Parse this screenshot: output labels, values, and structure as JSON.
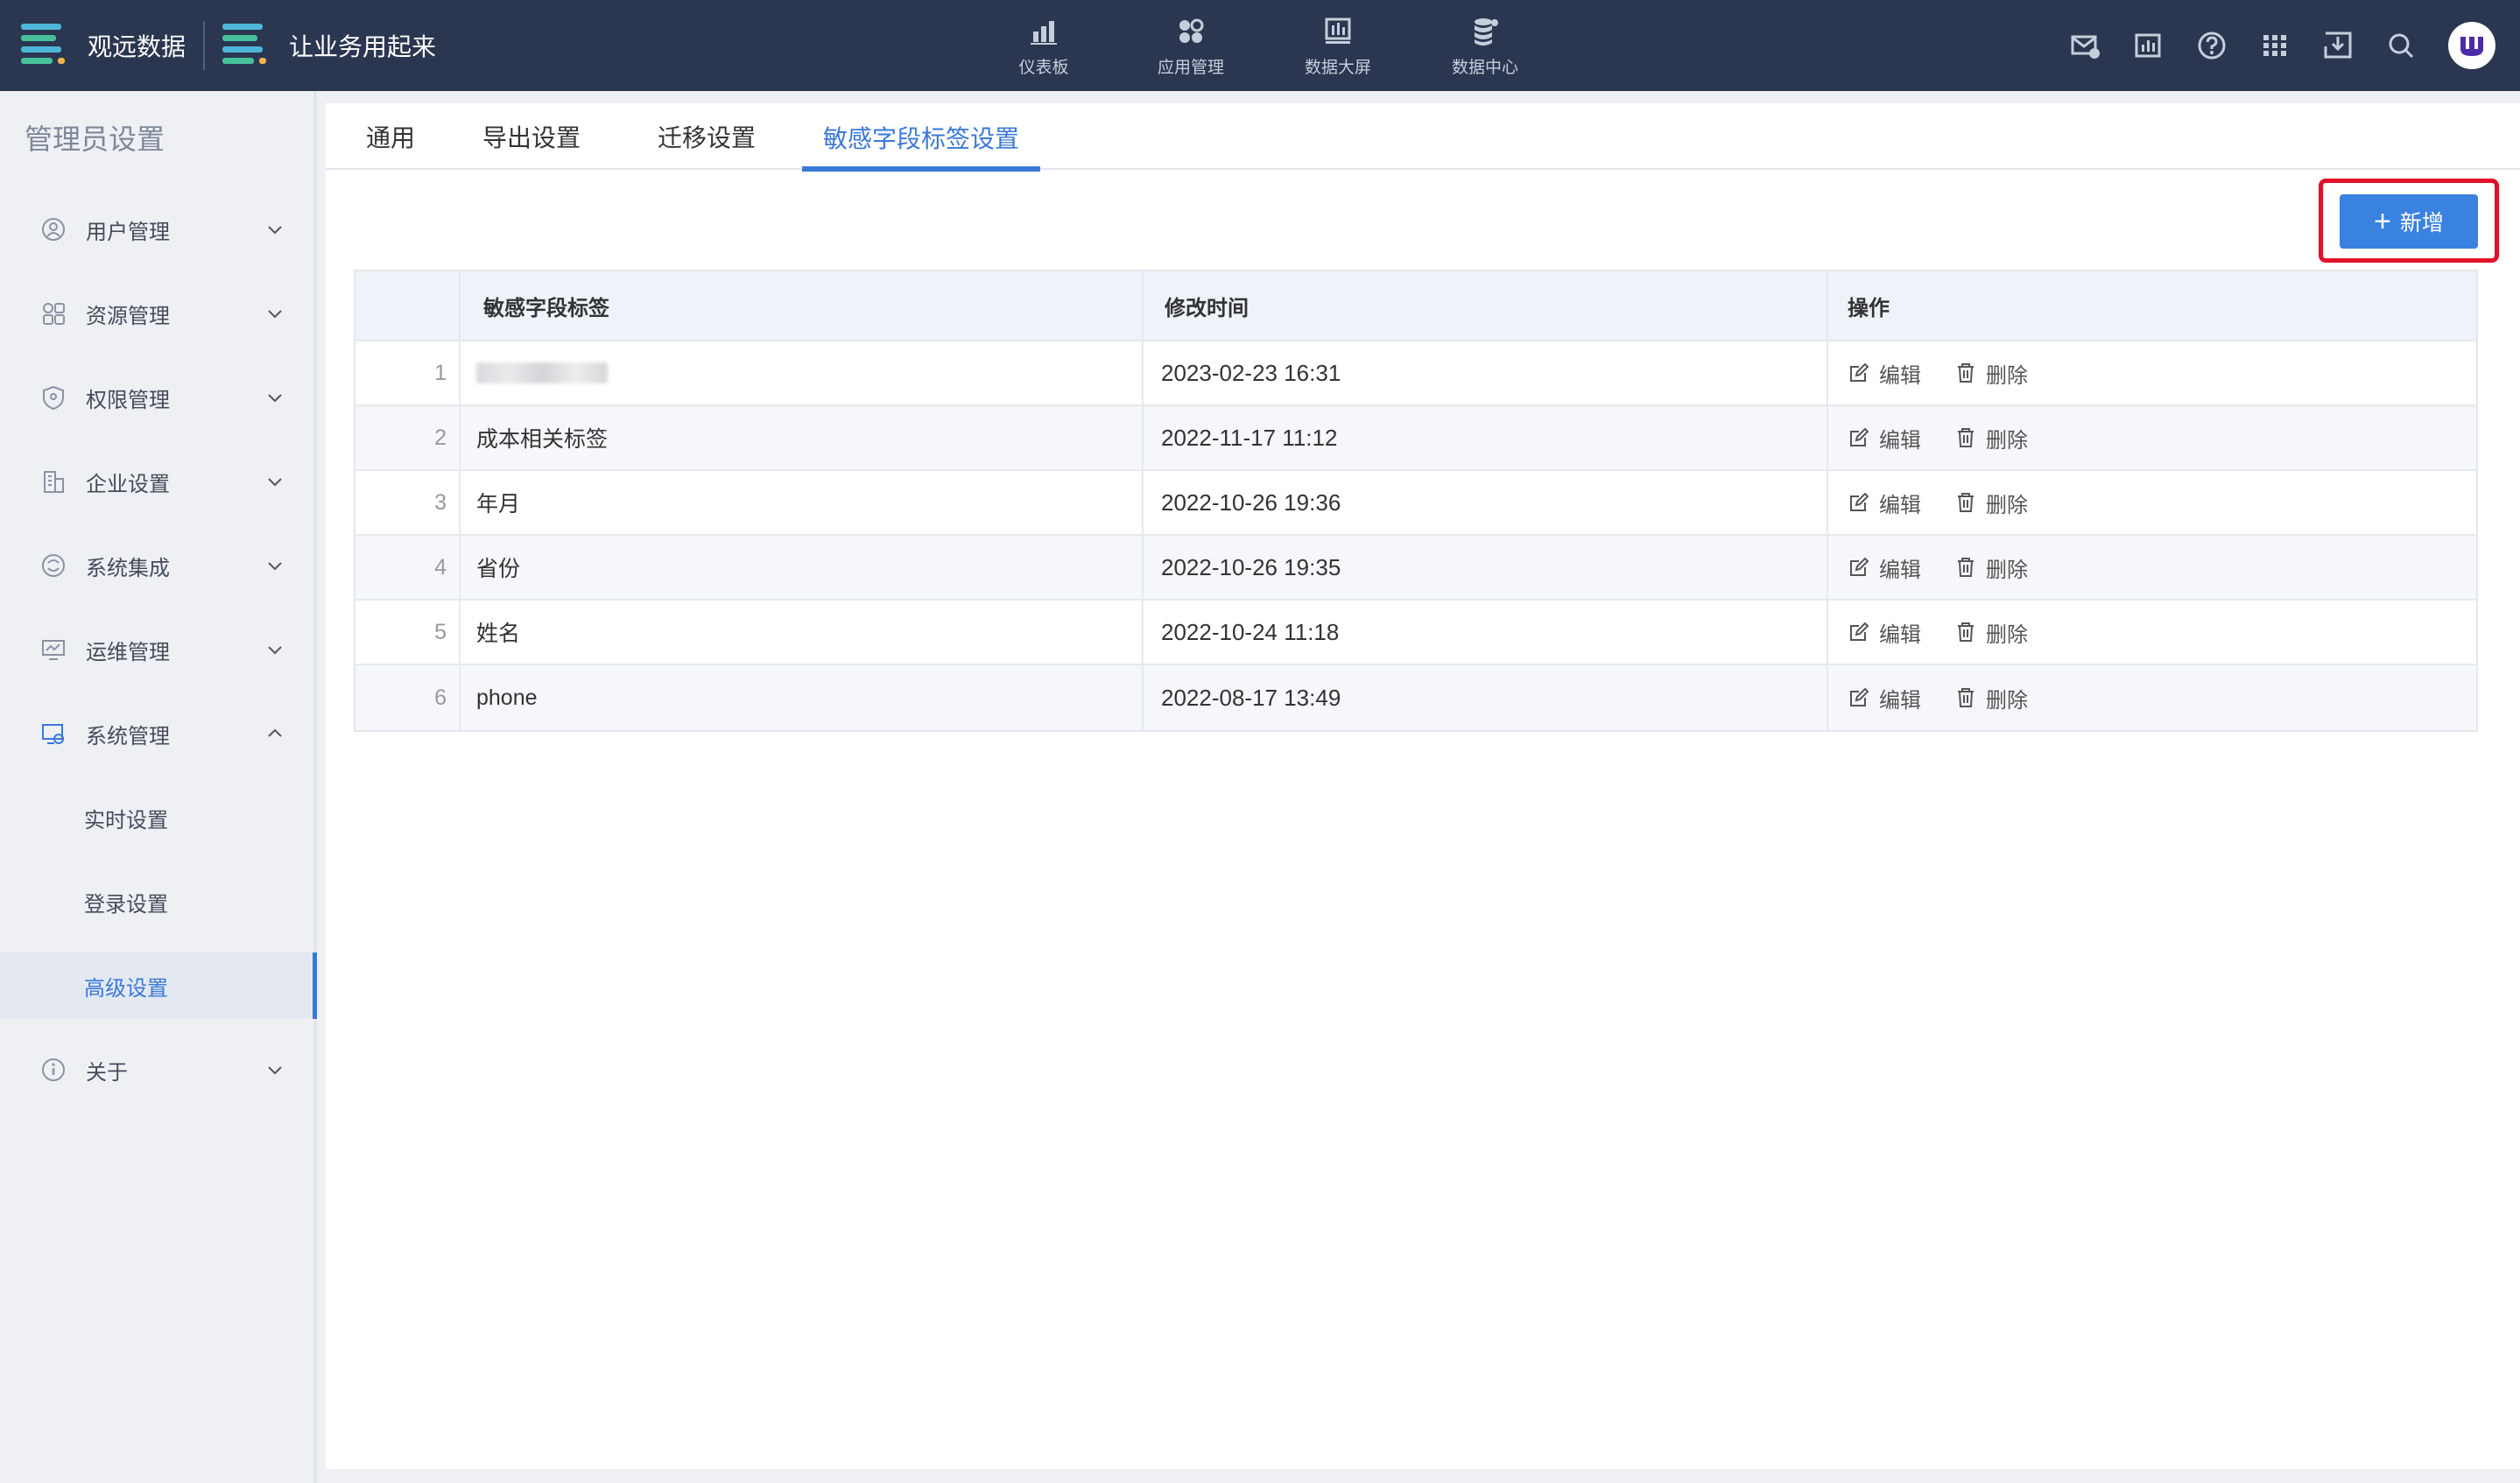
{
  "topbar": {
    "brand_left": "观远数据",
    "brand_right": "让业务用起来",
    "nav": [
      {
        "label": "仪表板",
        "icon": "bar-chart-icon"
      },
      {
        "label": "应用管理",
        "icon": "apps-grid-icon"
      },
      {
        "label": "数据大屏",
        "icon": "big-screen-icon"
      },
      {
        "label": "数据中心",
        "icon": "database-icon"
      }
    ],
    "icons": [
      "mail-settings-icon",
      "report-icon",
      "help-icon",
      "app-grid-icon",
      "download-inbox-icon",
      "search-icon"
    ]
  },
  "sidebar": {
    "title": "管理员设置",
    "items": [
      {
        "label": "用户管理",
        "icon": "user-icon",
        "expanded": false
      },
      {
        "label": "资源管理",
        "icon": "resource-icon",
        "expanded": false
      },
      {
        "label": "权限管理",
        "icon": "shield-icon",
        "expanded": false
      },
      {
        "label": "企业设置",
        "icon": "building-icon",
        "expanded": false
      },
      {
        "label": "系统集成",
        "icon": "integration-icon",
        "expanded": false
      },
      {
        "label": "运维管理",
        "icon": "monitor-icon",
        "expanded": false
      },
      {
        "label": "系统管理",
        "icon": "system-settings-icon",
        "expanded": true
      }
    ],
    "sub_items": [
      {
        "label": "实时设置",
        "active": false
      },
      {
        "label": "登录设置",
        "active": false
      },
      {
        "label": "高级设置",
        "active": true
      }
    ],
    "about": {
      "label": "关于",
      "icon": "info-icon"
    }
  },
  "tabs": [
    {
      "label": "通用",
      "active": false
    },
    {
      "label": "导出设置",
      "active": false
    },
    {
      "label": "迁移设置",
      "active": false
    },
    {
      "label": "敏感字段标签设置",
      "active": true
    }
  ],
  "add_button": {
    "label": "新增",
    "icon": "plus-icon"
  },
  "table": {
    "columns": [
      "",
      "敏感字段标签",
      "修改时间",
      "操作"
    ],
    "rows": [
      {
        "index": "1",
        "tag": "",
        "tag_redacted": true,
        "time": "2023-02-23 16:31"
      },
      {
        "index": "2",
        "tag": "成本相关标签",
        "time": "2022-11-17 11:12"
      },
      {
        "index": "3",
        "tag": "年月",
        "time": "2022-10-26 19:36"
      },
      {
        "index": "4",
        "tag": "省份",
        "time": "2022-10-26 19:35"
      },
      {
        "index": "5",
        "tag": "姓名",
        "time": "2022-10-24 11:18"
      },
      {
        "index": "6",
        "tag": "phone",
        "time": "2022-08-17 13:49"
      }
    ],
    "actions": {
      "edit": "编辑",
      "delete": "删除"
    }
  },
  "colors": {
    "topbar": "#2b3650",
    "accent": "#3a78d8",
    "highlight": "#e3102b"
  }
}
